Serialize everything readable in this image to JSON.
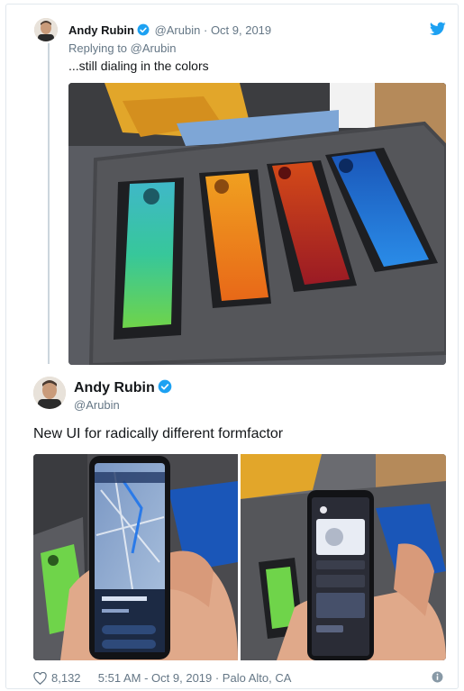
{
  "reply_tweet": {
    "author_name": "Andy Rubin",
    "handle": "@Arubin",
    "separator": "·",
    "date": "Oct 9, 2019",
    "replying_prefix": "Replying to",
    "replying_handle": "@Arubin",
    "text": "...still dialing in the colors"
  },
  "main_tweet": {
    "author_name": "Andy Rubin",
    "handle": "@Arubin",
    "text": "New UI for radically different formfactor"
  },
  "footer": {
    "likes": "8,132",
    "timestamp": "5:51 AM - Oct 9, 2019 · Palo Alto, CA"
  },
  "icons": {
    "verified": "verified-badge-icon",
    "twitter": "twitter-bird-icon",
    "like": "heart-icon",
    "info": "info-icon"
  },
  "colors": {
    "accent": "#1da1f2",
    "text_primary": "#14171a",
    "text_secondary": "#657786",
    "border": "#e1e8ed"
  }
}
